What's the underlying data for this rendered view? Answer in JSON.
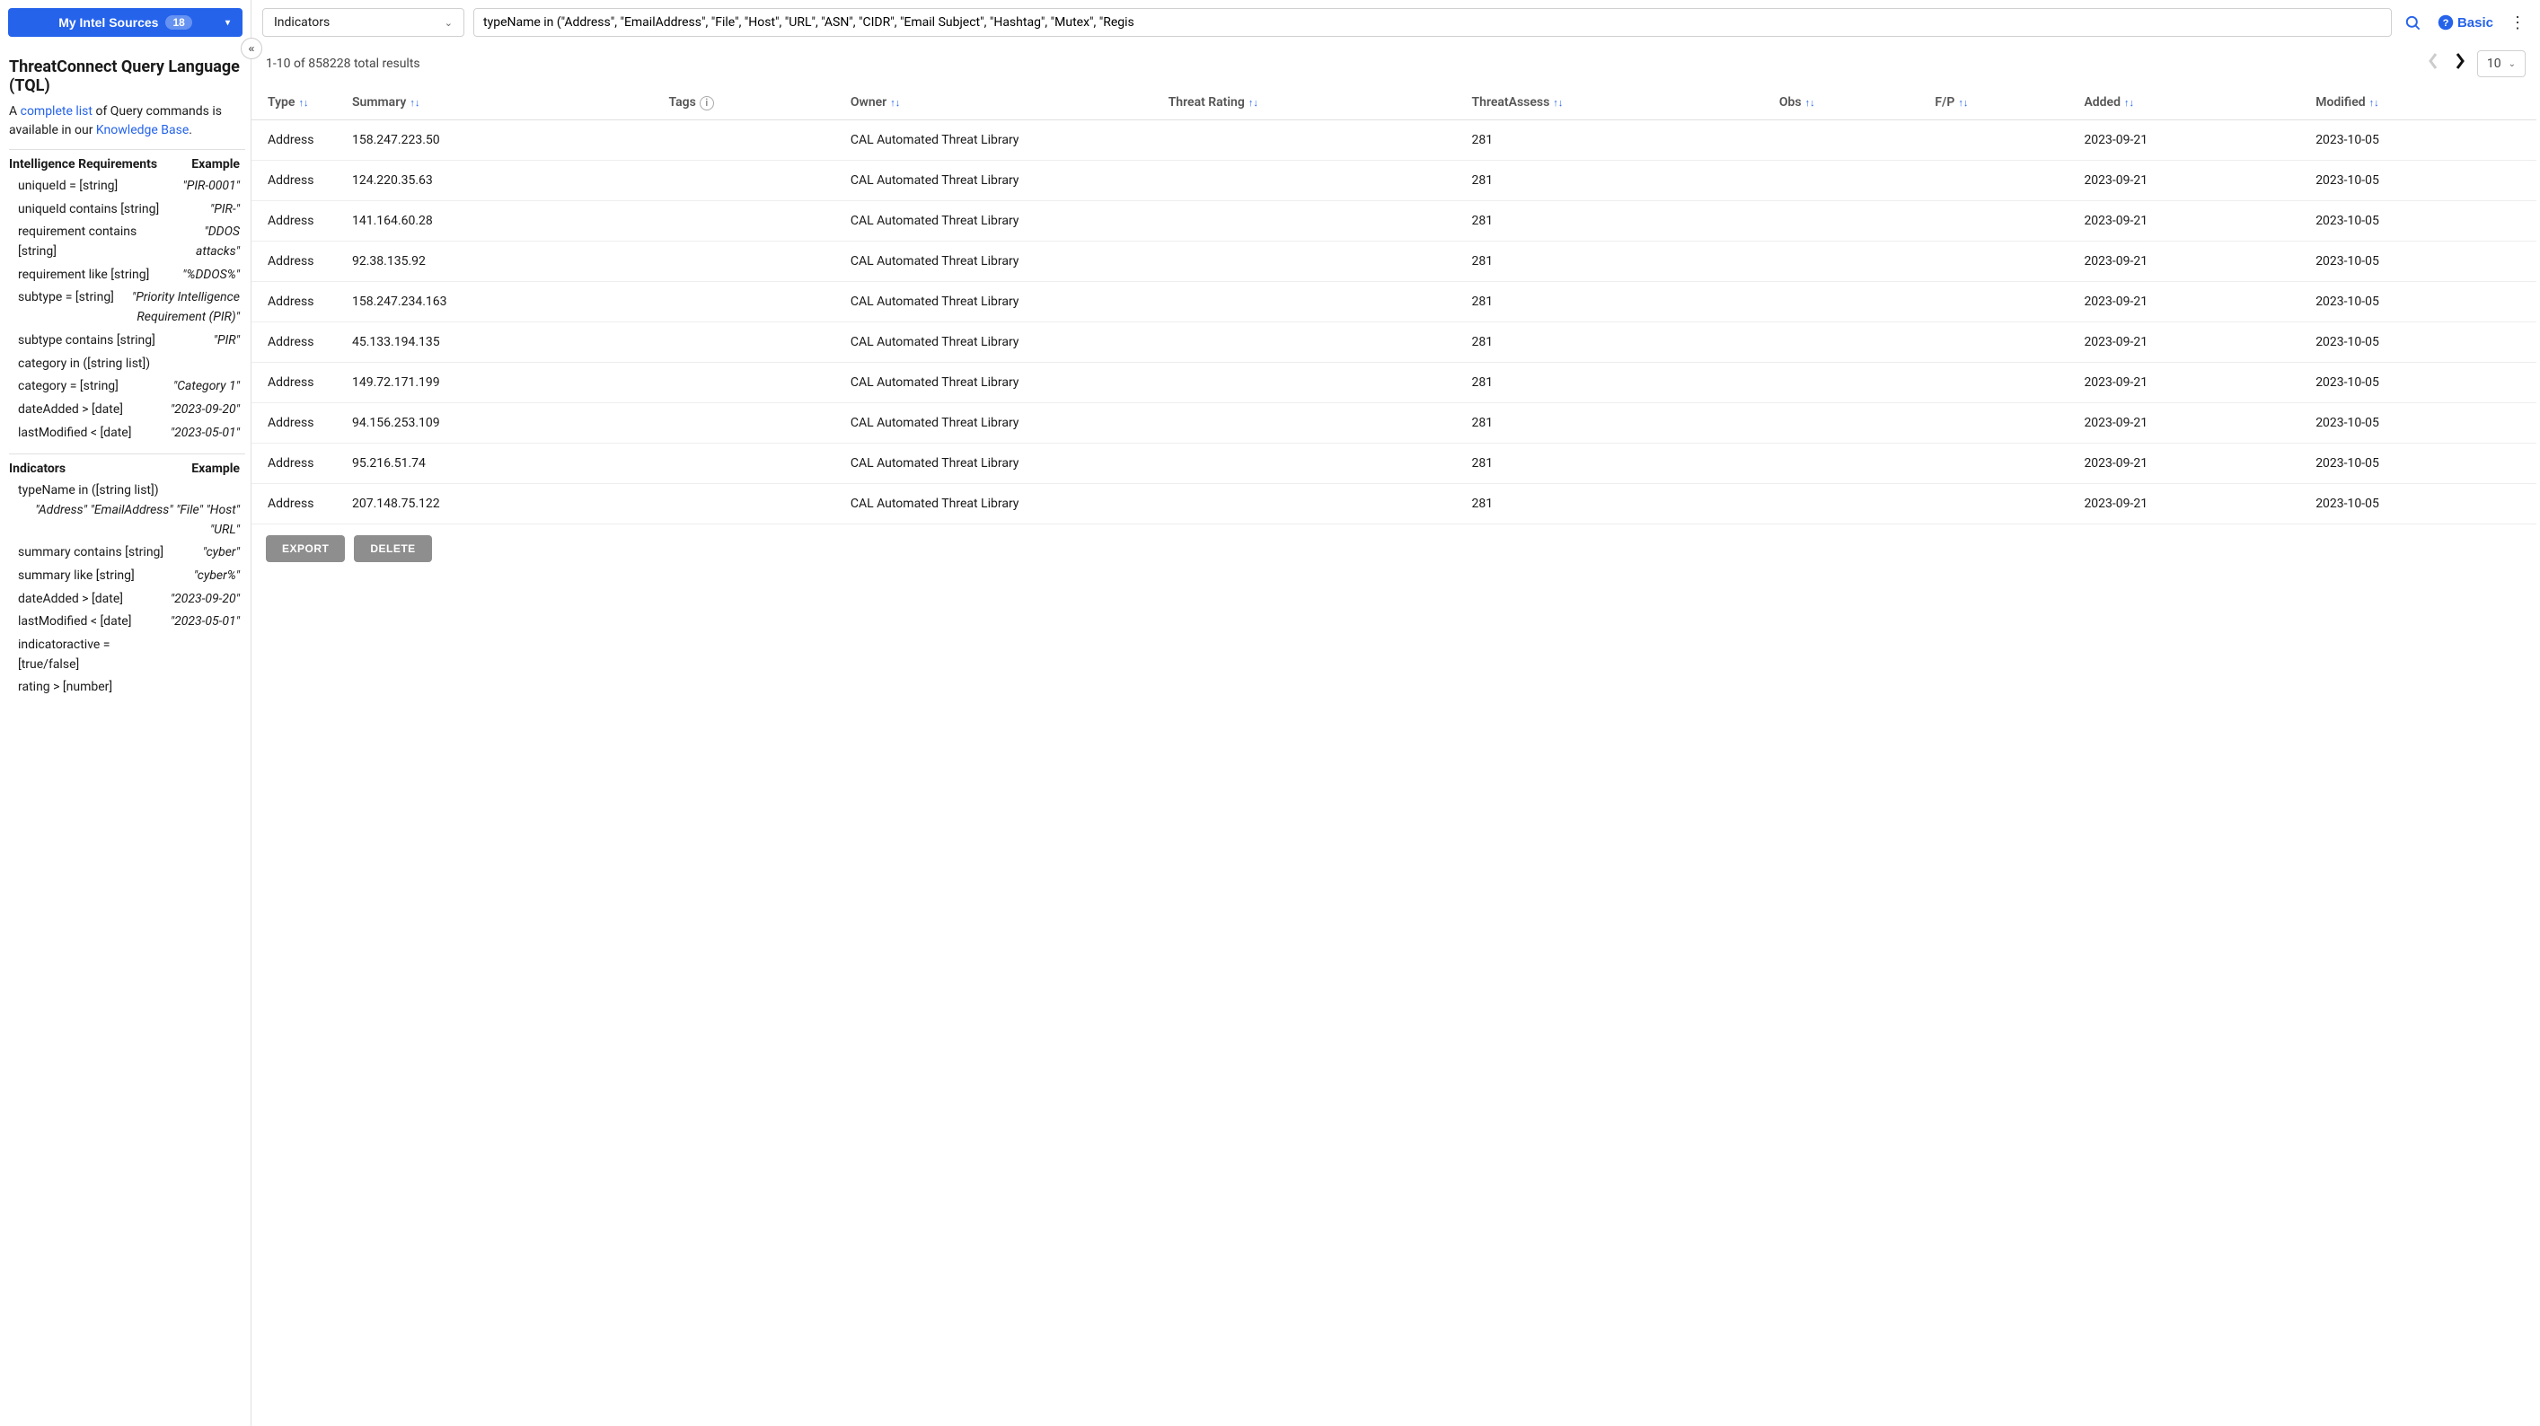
{
  "sidebar": {
    "sources_label": "My Intel Sources",
    "sources_count": "18",
    "tql_title": "ThreatConnect Query Language (TQL)",
    "intro_prefix": "A ",
    "intro_link1": "complete list",
    "intro_mid": " of Query commands is available in our ",
    "intro_link2": "Knowledge Base",
    "intro_suffix": ".",
    "example_header": "Example",
    "sections": [
      {
        "title": "Intelligence Requirements",
        "rows": [
          {
            "cmd": "uniqueId = [string]",
            "ex": "\"PIR-0001\""
          },
          {
            "cmd": "uniqueId contains [string]",
            "ex": "\"PIR-\""
          },
          {
            "cmd": "requirement contains [string]",
            "ex": "\"DDOS attacks\""
          },
          {
            "cmd": "requirement like [string]",
            "ex": "\"%DDOS%\""
          },
          {
            "cmd": "subtype = [string]",
            "ex": "\"Priority Intelligence Requirement (PIR)\""
          },
          {
            "cmd": "subtype contains [string]",
            "ex": "\"PIR\""
          },
          {
            "cmd": "category in ([string list])",
            "ex": ""
          },
          {
            "cmd": "category = [string]",
            "ex": "\"Category 1\""
          },
          {
            "cmd": "dateAdded > [date]",
            "ex": "\"2023-09-20\""
          },
          {
            "cmd": "lastModified < [date]",
            "ex": "\"2023-05-01\""
          }
        ]
      },
      {
        "title": "Indicators",
        "rows": [
          {
            "cmd": "typeName in ([string list])",
            "ex": "\"Address\" \"EmailAddress\" \"File\" \"Host\" \"URL\""
          },
          {
            "cmd": "summary contains [string]",
            "ex": "\"cyber\""
          },
          {
            "cmd": "summary like [string]",
            "ex": "\"cyber%\""
          },
          {
            "cmd": "dateAdded > [date]",
            "ex": "\"2023-09-20\""
          },
          {
            "cmd": "lastModified < [date]",
            "ex": "\"2023-05-01\""
          },
          {
            "cmd": "indicatoractive = [true/false]",
            "ex": ""
          },
          {
            "cmd": "rating > [number]",
            "ex": ""
          }
        ]
      }
    ]
  },
  "toolbar": {
    "type_select": "Indicators",
    "query_value": "typeName in (\"Address\", \"EmailAddress\", \"File\", \"Host\", \"URL\", \"ASN\", \"CIDR\", \"Email Subject\", \"Hashtag\", \"Mutex\", \"Regis",
    "basic_label": "Basic"
  },
  "results": {
    "meta_text": "1-10 of 858228 total results",
    "page_size": "10"
  },
  "table": {
    "headers": {
      "type": "Type",
      "summary": "Summary",
      "tags": "Tags",
      "owner": "Owner",
      "threat_rating": "Threat Rating",
      "threat_assess": "ThreatAssess",
      "obs": "Obs",
      "fp": "F/P",
      "added": "Added",
      "modified": "Modified"
    },
    "rows": [
      {
        "type": "Address",
        "summary": "158.247.223.50",
        "owner": "CAL Automated Threat Library",
        "assess": "281",
        "added": "2023-09-21",
        "modified": "2023-10-05"
      },
      {
        "type": "Address",
        "summary": "124.220.35.63",
        "owner": "CAL Automated Threat Library",
        "assess": "281",
        "added": "2023-09-21",
        "modified": "2023-10-05"
      },
      {
        "type": "Address",
        "summary": "141.164.60.28",
        "owner": "CAL Automated Threat Library",
        "assess": "281",
        "added": "2023-09-21",
        "modified": "2023-10-05"
      },
      {
        "type": "Address",
        "summary": "92.38.135.92",
        "owner": "CAL Automated Threat Library",
        "assess": "281",
        "added": "2023-09-21",
        "modified": "2023-10-05"
      },
      {
        "type": "Address",
        "summary": "158.247.234.163",
        "owner": "CAL Automated Threat Library",
        "assess": "281",
        "added": "2023-09-21",
        "modified": "2023-10-05"
      },
      {
        "type": "Address",
        "summary": "45.133.194.135",
        "owner": "CAL Automated Threat Library",
        "assess": "281",
        "added": "2023-09-21",
        "modified": "2023-10-05"
      },
      {
        "type": "Address",
        "summary": "149.72.171.199",
        "owner": "CAL Automated Threat Library",
        "assess": "281",
        "added": "2023-09-21",
        "modified": "2023-10-05"
      },
      {
        "type": "Address",
        "summary": "94.156.253.109",
        "owner": "CAL Automated Threat Library",
        "assess": "281",
        "added": "2023-09-21",
        "modified": "2023-10-05"
      },
      {
        "type": "Address",
        "summary": "95.216.51.74",
        "owner": "CAL Automated Threat Library",
        "assess": "281",
        "added": "2023-09-21",
        "modified": "2023-10-05"
      },
      {
        "type": "Address",
        "summary": "207.148.75.122",
        "owner": "CAL Automated Threat Library",
        "assess": "281",
        "added": "2023-09-21",
        "modified": "2023-10-05"
      }
    ]
  },
  "actions": {
    "export": "EXPORT",
    "delete": "DELETE"
  }
}
